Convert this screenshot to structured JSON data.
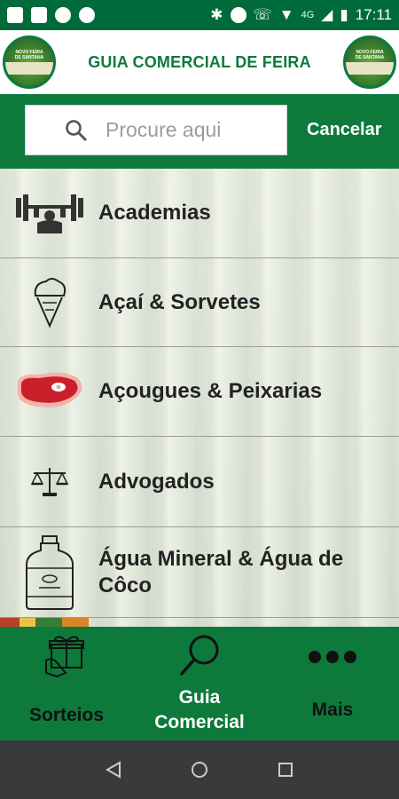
{
  "status_bar": {
    "time": "17:11",
    "network": "4G"
  },
  "header": {
    "title": "GUIA COMERCIAL DE FEIRA",
    "logo_text": "NOVO FEIRA DE SANTANA"
  },
  "search": {
    "placeholder": "Procure aqui",
    "value": "",
    "cancel_label": "Cancelar"
  },
  "categories": [
    {
      "label": "Academias",
      "icon": "gym-icon"
    },
    {
      "label": "Açaí & Sorvetes",
      "icon": "ice-cream-icon"
    },
    {
      "label": "Açougues & Peixarias",
      "icon": "meat-steak-icon"
    },
    {
      "label": "Advogados",
      "icon": "scales-of-justice-icon"
    },
    {
      "label": "Água Mineral & Água de Côco",
      "icon": "water-jug-icon"
    }
  ],
  "bottom_nav": [
    {
      "label": "Sorteios",
      "icon": "gift-icon",
      "active": false
    },
    {
      "label": "Guia Comercial",
      "icon": "search-icon",
      "active": true
    },
    {
      "label": "Mais",
      "icon": "more-dots-icon",
      "active": false
    }
  ],
  "colors": {
    "brand_green": "#0d7a3c",
    "header_text": "#0d7a3c",
    "active_nav_text": "#ffffff"
  }
}
